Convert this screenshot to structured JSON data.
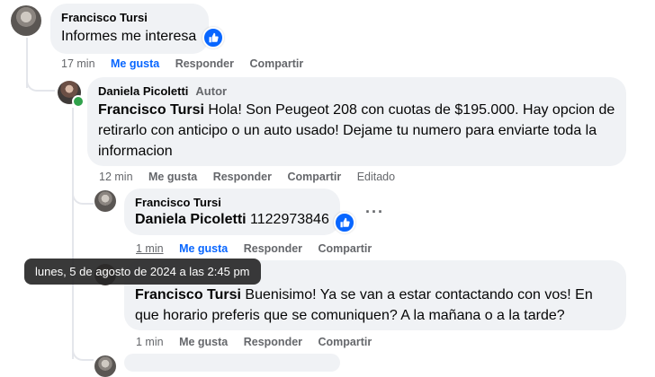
{
  "comments": [
    {
      "author": "Francisco Tursi",
      "text": "Informes me interesa",
      "time": "17 min",
      "like_label": "Me gusta",
      "reply_label": "Responder",
      "share_label": "Compartir"
    },
    {
      "author": "Daniela Picoletti",
      "badge": "Autor",
      "mention": "Francisco Tursi",
      "text": " Hola! Son Peugeot 208 con cuotas de $195.000. Hay opcion de retirarlo con anticipo o un auto usado! Dejame tu numero para enviarte toda la informacion",
      "time": "12 min",
      "like_label": "Me gusta",
      "reply_label": "Responder",
      "share_label": "Compartir",
      "edited_label": "Editado"
    },
    {
      "author": "Francisco Tursi",
      "mention": "Daniela Picoletti",
      "text": " 1122973846",
      "time": "1 min",
      "like_label": "Me gusta",
      "reply_label": "Responder",
      "share_label": "Compartir"
    },
    {
      "mention": "Francisco Tursi",
      "text": " Buenisimo! Ya se van a estar contactando con vos! En que horario preferis que se comuniquen? A la mañana o a la tarde?",
      "time": "1 min",
      "like_label": "Me gusta",
      "reply_label": "Responder",
      "share_label": "Compartir"
    }
  ],
  "tooltip": "lunes, 5 de agosto de 2024 a las 2:45 pm",
  "icons": {
    "reaction": "like-thumb-icon",
    "more": "more-options-icon"
  },
  "colors": {
    "accent": "#0866ff",
    "bubble": "#f0f2f5",
    "online": "#31a24c"
  }
}
